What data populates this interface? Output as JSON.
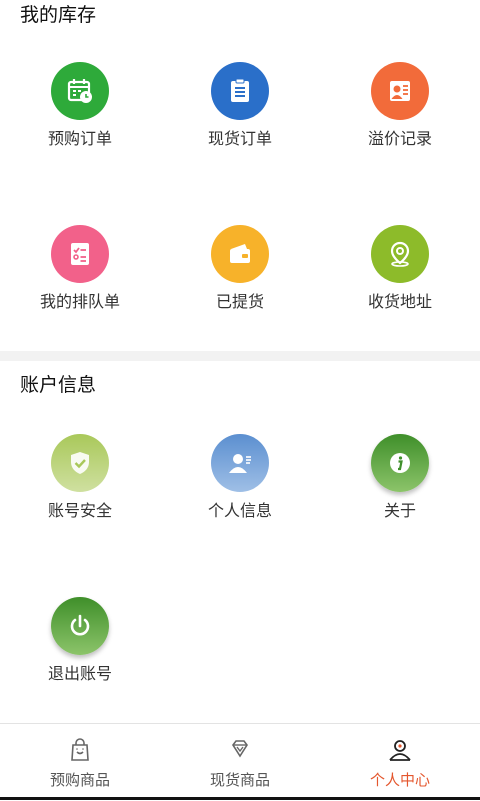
{
  "inventory": {
    "title": "我的库存",
    "items": [
      {
        "label": "预购订单",
        "icon": "calendar-clock-icon",
        "color": "#2eaa3a"
      },
      {
        "label": "现货订单",
        "icon": "clipboard-icon",
        "color": "#2a6fc9"
      },
      {
        "label": "溢价记录",
        "icon": "contact-card-icon",
        "color": "#f26b3a"
      },
      {
        "label": "我的排队单",
        "icon": "checklist-icon",
        "color": "#f2618a"
      },
      {
        "label": "已提货",
        "icon": "wallet-icon",
        "color": "#f7b22a"
      },
      {
        "label": "收货地址",
        "icon": "location-pin-icon",
        "color": "#8dbb2a"
      }
    ]
  },
  "account": {
    "title": "账户信息",
    "items": [
      {
        "label": "账号安全",
        "icon": "shield-check-icon",
        "color": "#b9d27a"
      },
      {
        "label": "个人信息",
        "icon": "user-card-icon",
        "color": "#7aa3d6"
      },
      {
        "label": "关于",
        "icon": "info-icon",
        "color": "#5aa23a"
      },
      {
        "label": "退出账号",
        "icon": "power-icon",
        "color": "#4f9a2e"
      }
    ]
  },
  "tabbar": {
    "tabs": [
      {
        "label": "预购商品",
        "icon": "shopping-bag-icon",
        "active": false
      },
      {
        "label": "现货商品",
        "icon": "diamond-icon",
        "active": false
      },
      {
        "label": "个人中心",
        "icon": "user-profile-icon",
        "active": true
      }
    ],
    "active_color": "#e4572e"
  }
}
